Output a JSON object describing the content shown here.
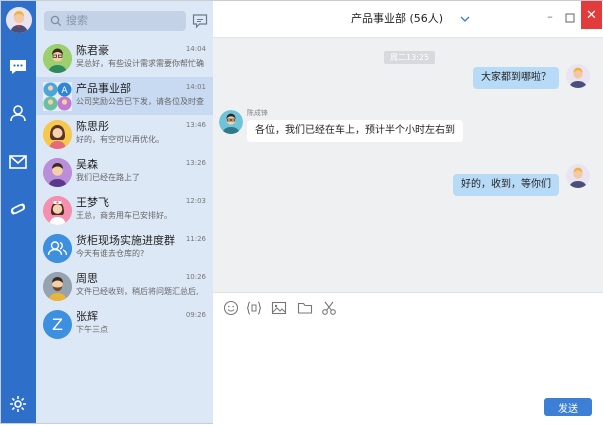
{
  "search": {
    "placeholder": "搜索"
  },
  "conversations": [
    {
      "name": "陈君豪",
      "time": "14:04",
      "preview": "吴总好，有些设计需求需要你帮忙确",
      "avatar": "man-glasses"
    },
    {
      "name": "产品事业部",
      "time": "14:01",
      "preview": "公司奖励公告已下发，请各位及时查",
      "avatar": "group",
      "active": true
    },
    {
      "name": "陈思彤",
      "time": "13:46",
      "preview": "好的，有空可以再优化。",
      "avatar": "woman"
    },
    {
      "name": "吴森",
      "time": "13:26",
      "preview": "我们已经在路上了",
      "avatar": "man-purple"
    },
    {
      "name": "王梦飞",
      "time": "12:03",
      "preview": "王总，商务用车已安排好。",
      "avatar": "nurse"
    },
    {
      "name": "货柜现场实施进度群",
      "time": "11:26",
      "preview": "今天有谁去仓库的?",
      "avatar": "group-icon"
    },
    {
      "name": "周思",
      "time": "10:26",
      "preview": "文件已经收到，稍后将问题汇总后,",
      "avatar": "man-beard"
    },
    {
      "name": "张辉",
      "time": "09:26",
      "preview": "下午三点",
      "avatar": "letter-z",
      "avatar_letter": "Z"
    }
  ],
  "chat": {
    "title": "产品事业部 (56人)",
    "window": {
      "minimize": "–",
      "close": "✕"
    },
    "time_divider": "周二13:25",
    "messages": [
      {
        "dir": "out",
        "text": "大家都到哪啦？"
      },
      {
        "dir": "in",
        "sender": "陈成锋",
        "text": "各位，我们已经在车上，预计半个小时左右到"
      },
      {
        "dir": "out",
        "text": "好的，收到，等你们"
      }
    ],
    "send_label": "发送"
  },
  "colors": {
    "rail": "#2d6fc9",
    "list_bg": "#dde8f6",
    "active_item": "#c8daf1",
    "out_bubble": "#b7dbf7",
    "send": "#3c7fd4",
    "close": "#e23b3b"
  }
}
